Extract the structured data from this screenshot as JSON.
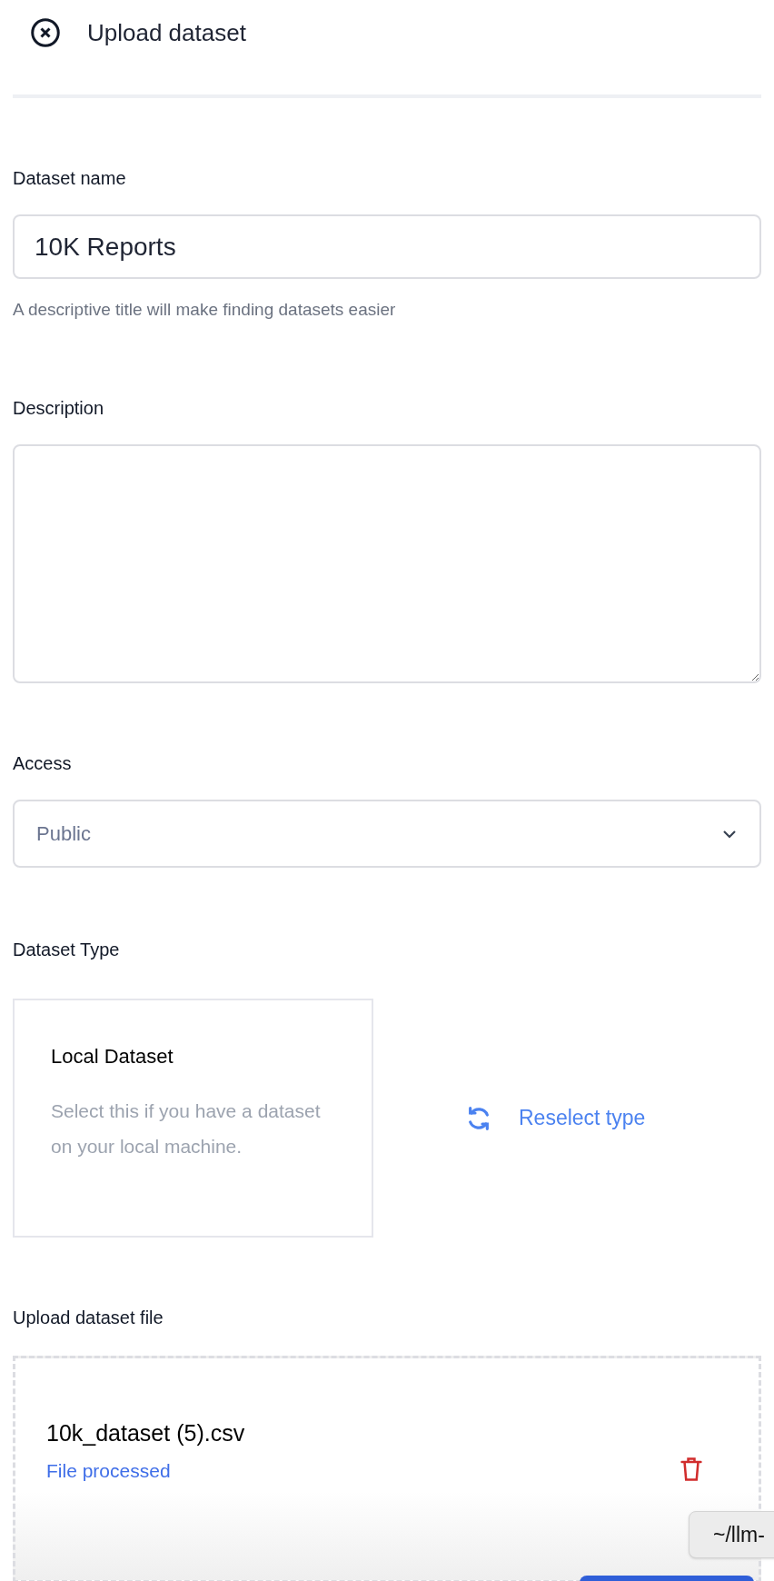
{
  "header": {
    "title": "Upload dataset"
  },
  "name_field": {
    "label": "Dataset name",
    "value": "10K Reports",
    "hint": "A descriptive title will make finding datasets easier"
  },
  "description_field": {
    "label": "Description"
  },
  "access_field": {
    "label": "Access",
    "value": "Public"
  },
  "dataset_type": {
    "label": "Dataset Type",
    "card": {
      "title": "Local Dataset",
      "description": "Select this if you have a dataset on your local machine."
    },
    "reselect": "Reselect type"
  },
  "upload": {
    "label": "Upload dataset file",
    "file_name": "10k_dataset (5).csv",
    "status": "File processed"
  },
  "tooltip": {
    "text": "~/llm-"
  }
}
